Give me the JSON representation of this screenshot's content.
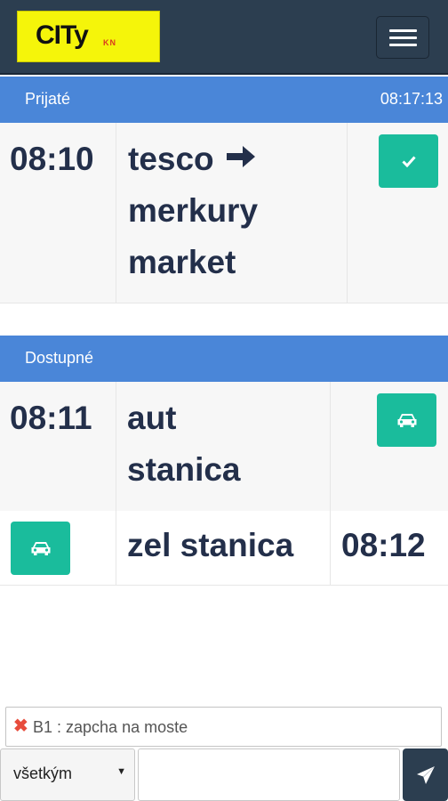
{
  "header": {
    "logo_text": "CITy",
    "logo_subtext": "KN",
    "menu_icon": "hamburger-icon"
  },
  "accepted": {
    "title": "Prijaté",
    "clock": "08:17:13",
    "rides": [
      {
        "time": "08:10",
        "from": "tesco",
        "arrow_icon": "arrow-right-icon",
        "to_line1": "merkury",
        "to_line2": "market",
        "action_icon": "check-icon"
      }
    ]
  },
  "available": {
    "title": "Dostupné",
    "rides": [
      {
        "time": "08:11",
        "place_line1": "aut",
        "place_line2": "stanica",
        "action_icon": "car-icon"
      },
      {
        "time": "08:12",
        "place": "zel stanica",
        "action_icon": "car-icon"
      }
    ]
  },
  "footer": {
    "message_icon": "close-icon",
    "message": "B1 : zapcha na moste",
    "recipient_selected": "všetkým",
    "message_input_value": "",
    "send_icon": "paper-plane-icon"
  },
  "colors": {
    "navbar": "#2c3e50",
    "logo_bg": "#f5f50a",
    "section_header": "#4a86d8",
    "action_button": "#1abc9c",
    "text_dark": "#232f4a"
  }
}
